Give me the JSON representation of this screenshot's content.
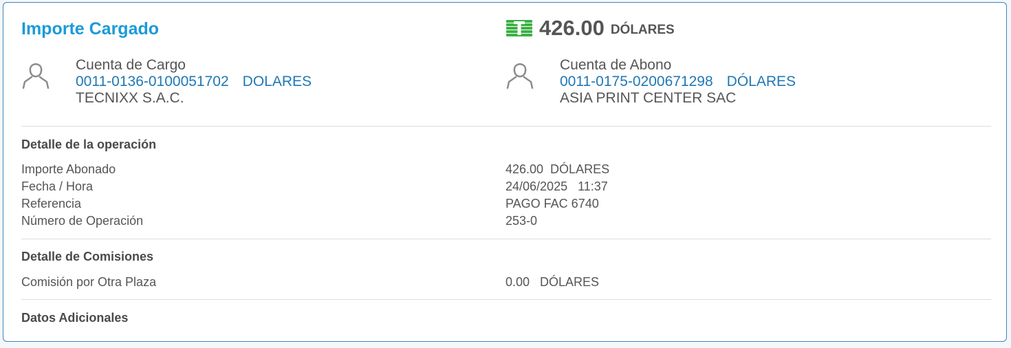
{
  "header": {
    "title": "Importe Cargado",
    "amount": "426.00",
    "currency": "DÓLARES",
    "money_icon": "money-bills-icon",
    "money_color": "#3cb043"
  },
  "cargo": {
    "label": "Cuenta de Cargo",
    "account_number": "0011-0136-0100051702",
    "account_currency": "DOLARES",
    "owner": "TECNIXX S.A.C.",
    "icon": "user-icon"
  },
  "abono": {
    "label": "Cuenta de Abono",
    "account_number": "0011-0175-0200671298",
    "account_currency": "DÓLARES",
    "owner": "ASIA PRINT CENTER SAC",
    "icon": "user-icon"
  },
  "operation": {
    "title": "Detalle de la operación",
    "rows": [
      {
        "label": "Importe Abonado",
        "value": "426.00  DÓLARES"
      },
      {
        "label": "Fecha / Hora",
        "value": "24/06/2025   11:37"
      },
      {
        "label": "Referencia",
        "value": "PAGO FAC 6740"
      },
      {
        "label": "Número de Operación",
        "value": "253-0"
      }
    ]
  },
  "commissions": {
    "title": "Detalle de Comisiones",
    "rows": [
      {
        "label": "Comisión por Otra Plaza",
        "value": "0.00   DÓLARES"
      }
    ]
  },
  "additional": {
    "title": "Datos Adicionales"
  },
  "colors": {
    "accent": "#1a9bd7",
    "link": "#1f78b4",
    "border": "#3c86b8"
  }
}
